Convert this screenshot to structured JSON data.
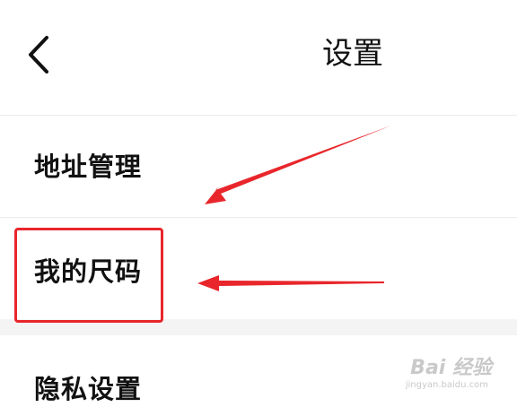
{
  "header": {
    "title": "设置",
    "back_icon": "chevron-left-icon"
  },
  "rows": [
    {
      "label": "地址管理"
    },
    {
      "label": "我的尺码"
    },
    {
      "label": "隐私设置"
    }
  ],
  "annotation": {
    "color": "#e8262b"
  },
  "watermark": {
    "text": "Bai 经验",
    "sub": "jingyan.baidu.com"
  }
}
